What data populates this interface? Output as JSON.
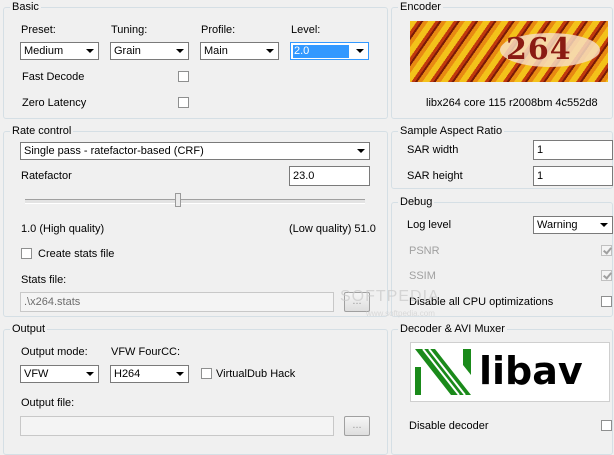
{
  "basic": {
    "title": "Basic",
    "preset_label": "Preset:",
    "preset_value": "Medium",
    "tuning_label": "Tuning:",
    "tuning_value": "Grain",
    "profile_label": "Profile:",
    "profile_value": "Main",
    "level_label": "Level:",
    "level_value": "2.0",
    "fast_decode_label": "Fast Decode",
    "fast_decode_checked": false,
    "zero_latency_label": "Zero Latency",
    "zero_latency_checked": false
  },
  "encoder": {
    "title": "Encoder",
    "logo_text": "264",
    "version": "libx264 core 115 r2008bm 4c552d8"
  },
  "rate_control": {
    "title": "Rate control",
    "mode_value": "Single pass - ratefactor-based (CRF)",
    "ratefactor_label": "Ratefactor",
    "ratefactor_value": "23.0",
    "ratefactor_fraction": 0.45,
    "high_quality_label": "1.0 (High quality)",
    "low_quality_label": "(Low quality) 51.0",
    "create_stats_label": "Create stats file",
    "stats_file_label": "Stats file:",
    "stats_file_value": ".\\x264.stats",
    "browse_label": "..."
  },
  "sar": {
    "title": "Sample Aspect Ratio",
    "width_label": "SAR width",
    "width_value": "1",
    "height_label": "SAR height",
    "height_value": "1"
  },
  "debug": {
    "title": "Debug",
    "log_level_label": "Log level",
    "log_level_value": "Warning",
    "psnr_label": "PSNR",
    "psnr_checked": true,
    "ssim_label": "SSIM",
    "ssim_checked": true,
    "disable_cpu_label": "Disable all CPU optimizations",
    "disable_cpu_checked": false
  },
  "output": {
    "title": "Output",
    "mode_label": "Output mode:",
    "mode_value": "VFW",
    "fourcc_label": "VFW FourCC:",
    "fourcc_value": "H264",
    "vdub_label": "VirtualDub Hack",
    "vdub_checked": false,
    "file_label": "Output file:",
    "file_value": "",
    "browse_label": "..."
  },
  "decoder": {
    "title": "Decoder & AVI Muxer",
    "logo_text": "libav",
    "disable_decoder_label": "Disable decoder",
    "disable_decoder_checked": false
  },
  "watermark": {
    "text": "SOFTPEDIA",
    "sub": "www.softpedia.com"
  },
  "colors": {
    "selection": "#3399ff",
    "group_border": "#d5dfe5",
    "libav_green": "#1a8a1a"
  }
}
